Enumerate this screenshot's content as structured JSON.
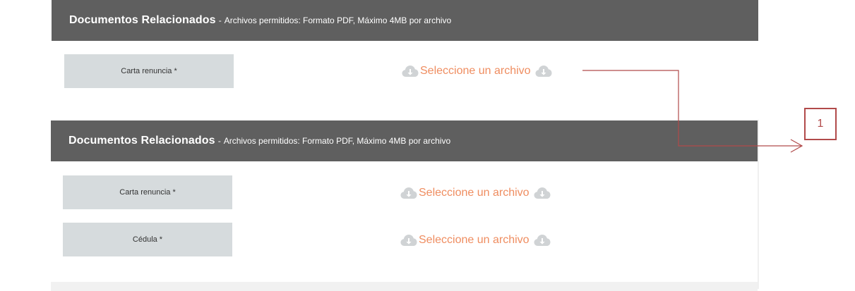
{
  "sections": [
    {
      "title": "Documentos Relacionados",
      "separator": "-",
      "subtitle": "Archivos permitidos: Formato PDF, Máximo 4MB por archivo",
      "rows": [
        {
          "label": "Carta renuncia *",
          "upload_text": "Seleccione un archivo"
        }
      ]
    },
    {
      "title": "Documentos Relacionados",
      "separator": "-",
      "subtitle": "Archivos permitidos: Formato PDF, Máximo 4MB por archivo",
      "rows": [
        {
          "label": "Carta renuncia *",
          "upload_text": "Seleccione un archivo"
        },
        {
          "label": "Cédula *",
          "upload_text": "Seleccione un archivo"
        }
      ]
    }
  ],
  "callout": {
    "number": "1"
  },
  "icons": {
    "upload": "cloud-download-icon"
  },
  "colors": {
    "header_bg": "#5f5f5f",
    "label_bg": "#d6dbdd",
    "upload_text": "#ef8d60",
    "cloud_icon": "#d0d3d5",
    "callout": "#b14a4a"
  }
}
